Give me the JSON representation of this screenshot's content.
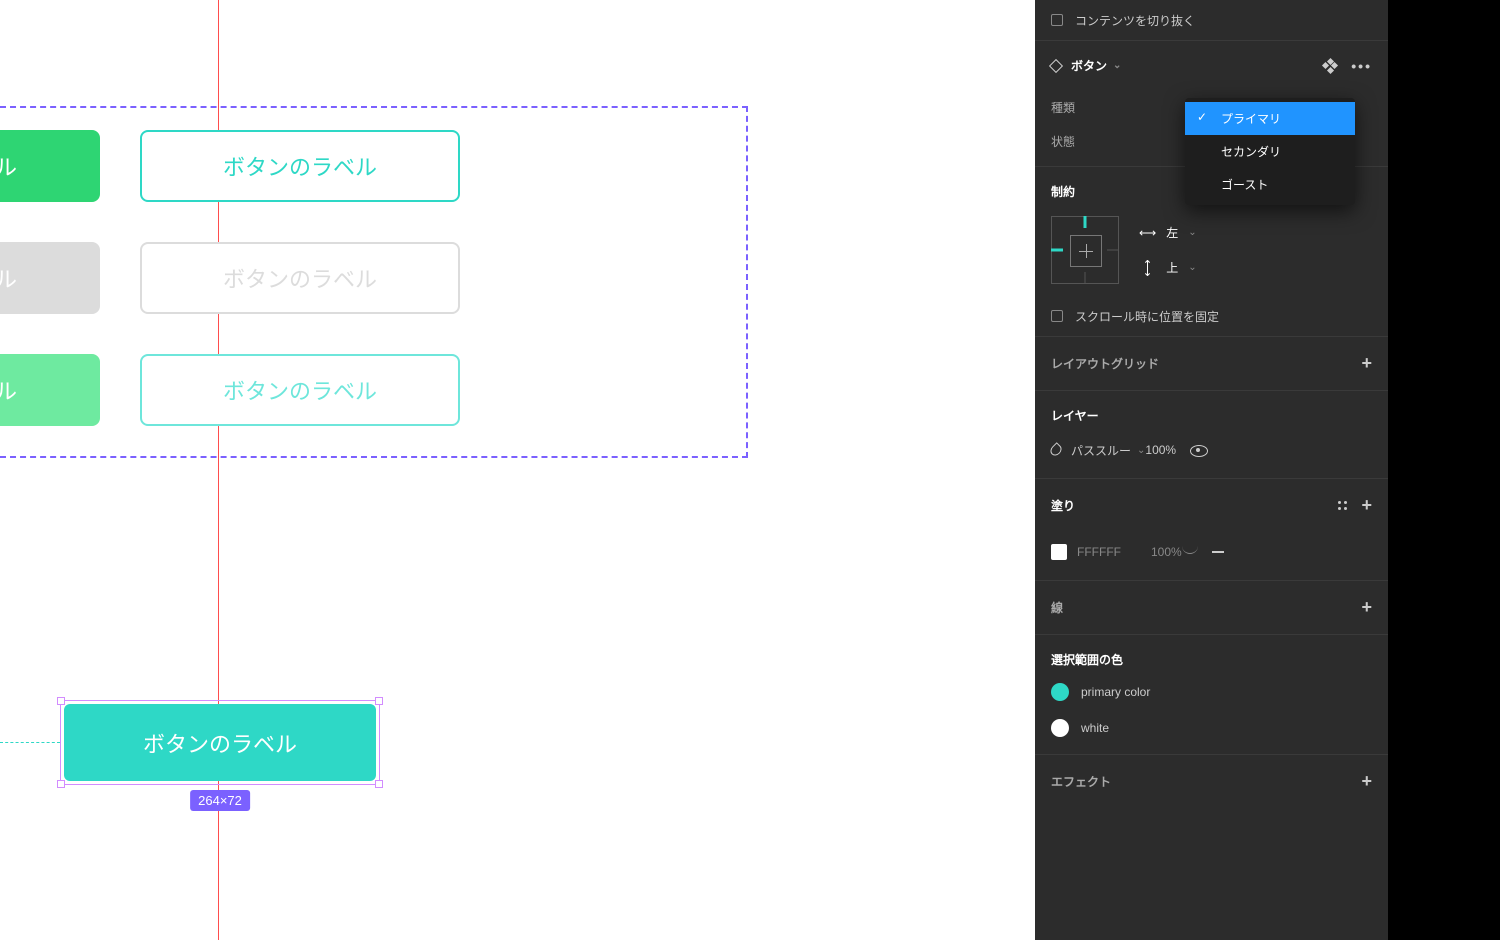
{
  "canvas": {
    "button_label": "ボタンのラベル",
    "selected_dimensions": "264×72"
  },
  "panel": {
    "clip_content": "コンテンツを切り抜く",
    "component": {
      "name": "ボタン",
      "props": {
        "type_label": "種類",
        "state_label": "状態"
      },
      "type_options": [
        "プライマリ",
        "セカンダリ",
        "ゴースト"
      ],
      "type_selected": "プライマリ"
    },
    "constraints": {
      "title": "制約",
      "horizontal": "左",
      "vertical": "上",
      "fix_scroll": "スクロール時に位置を固定"
    },
    "layout_grid": "レイアウトグリッド",
    "layer": {
      "title": "レイヤー",
      "blend_mode": "パススルー",
      "opacity": "100%"
    },
    "fill": {
      "title": "塗り",
      "hex": "FFFFFF",
      "opacity": "100%"
    },
    "stroke": {
      "title": "線"
    },
    "selection_colors": {
      "title": "選択範囲の色",
      "colors": [
        {
          "name": "primary color",
          "hex": "#2ed8c6"
        },
        {
          "name": "white",
          "hex": "#ffffff"
        }
      ]
    },
    "effects": {
      "title": "エフェクト"
    }
  }
}
